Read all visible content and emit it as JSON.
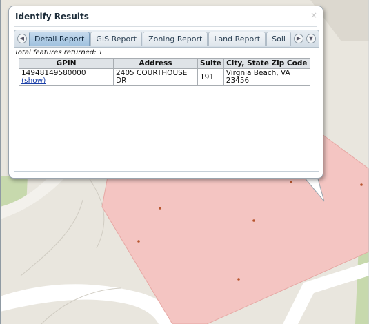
{
  "popup": {
    "title": "Identify Results",
    "close": "×"
  },
  "tabs": [
    "Detail Report",
    "GIS Report",
    "Zoning Report",
    "Land Report",
    "Soil"
  ],
  "active_tab": "Detail Report",
  "summary": "Total features returned: 1",
  "table": {
    "headers": [
      "GPIN",
      "Address",
      "Suite",
      "City, State Zip Code"
    ],
    "row": {
      "gpin": "14948149580000",
      "show_link": "(show)",
      "address": "2405 COURTHOUSE DR",
      "suite": "191",
      "city": "Virgnia Beach, VA 23456"
    }
  },
  "colors": {
    "parcel_fill": "#f4c5c2",
    "parcel_point": "#b7552e",
    "map_background": "#e9e6de",
    "road": "#ffffff",
    "green_area": "#c7d9ad"
  }
}
